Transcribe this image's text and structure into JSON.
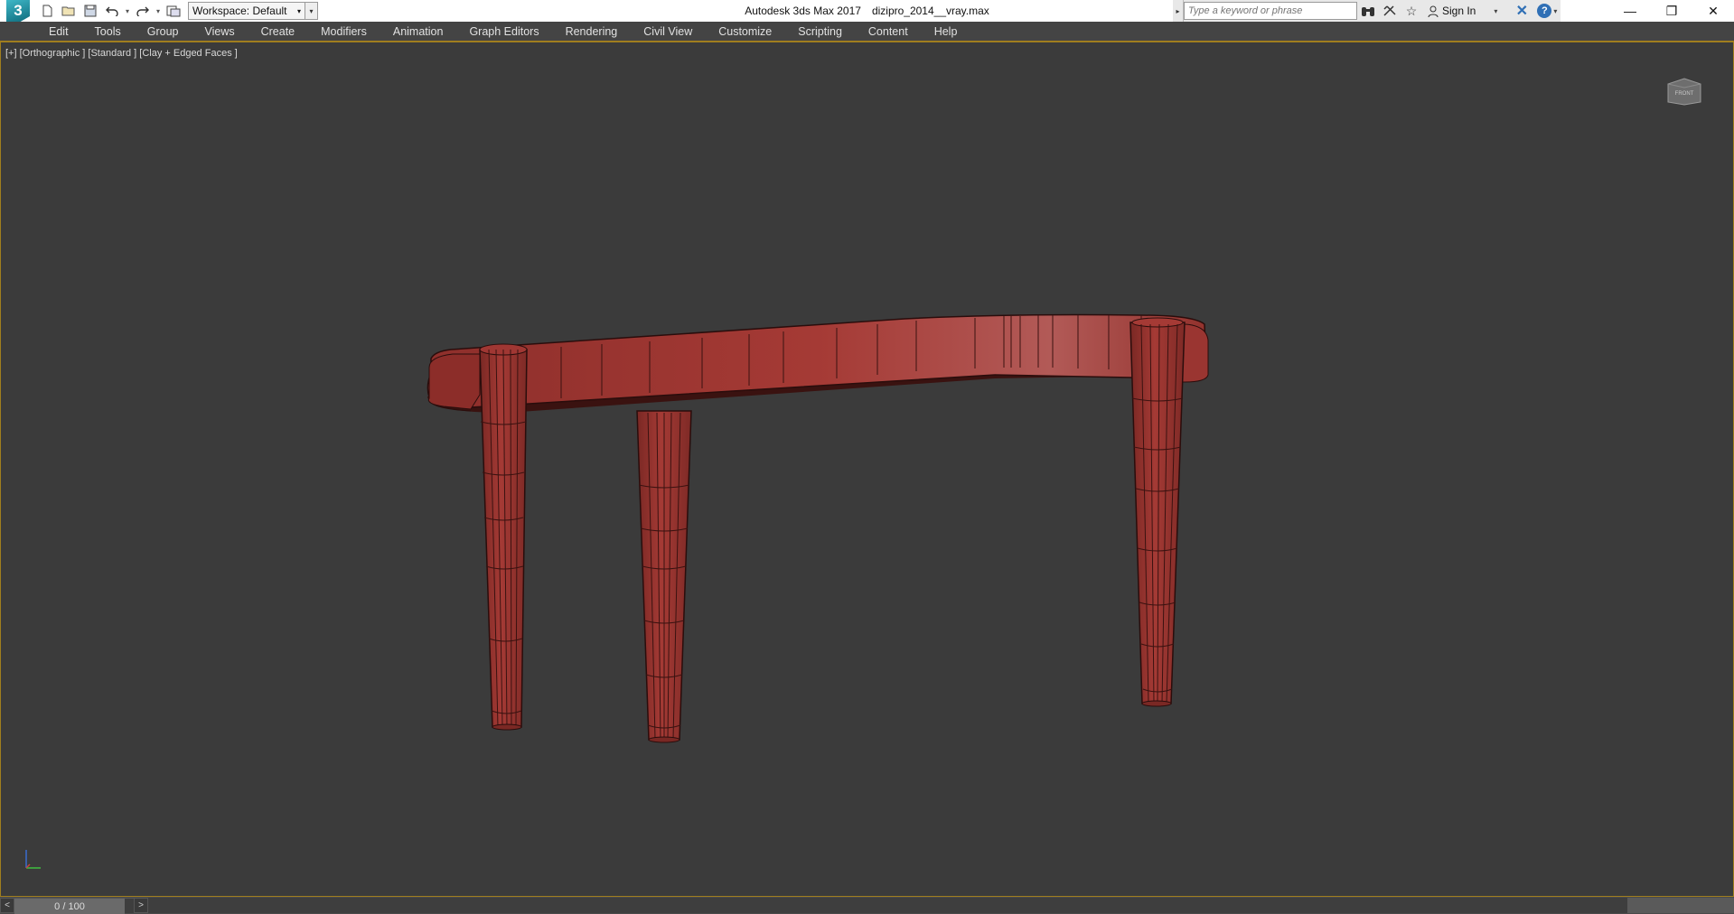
{
  "window": {
    "app_name": "Autodesk 3ds Max 2017",
    "file_name": "dizipro_2014__vray.max",
    "logo_text": "3",
    "minimize": "—",
    "restore": "❐",
    "close": "✕"
  },
  "quick_access": {
    "workspace_label": "Workspace: Default"
  },
  "infocenter": {
    "search_placeholder": "Type a keyword or phrase",
    "sign_in": "Sign In"
  },
  "menu": {
    "items": [
      "Edit",
      "Tools",
      "Group",
      "Views",
      "Create",
      "Modifiers",
      "Animation",
      "Graph Editors",
      "Rendering",
      "Civil View",
      "Customize",
      "Scripting",
      "Content",
      "Help"
    ]
  },
  "viewport": {
    "label": "[+] [Orthographic ] [Standard ] [Clay + Edged Faces ]",
    "model_color": "#a33a35",
    "background_color": "#3b3b3b"
  },
  "timeline": {
    "frame_display": "0 / 100",
    "prev": "<",
    "next": ">",
    "current_frame": 0,
    "total_frames": 100
  },
  "colors": {
    "active_border": "#a07e1e",
    "accent_blue": "#2f6fb5"
  }
}
